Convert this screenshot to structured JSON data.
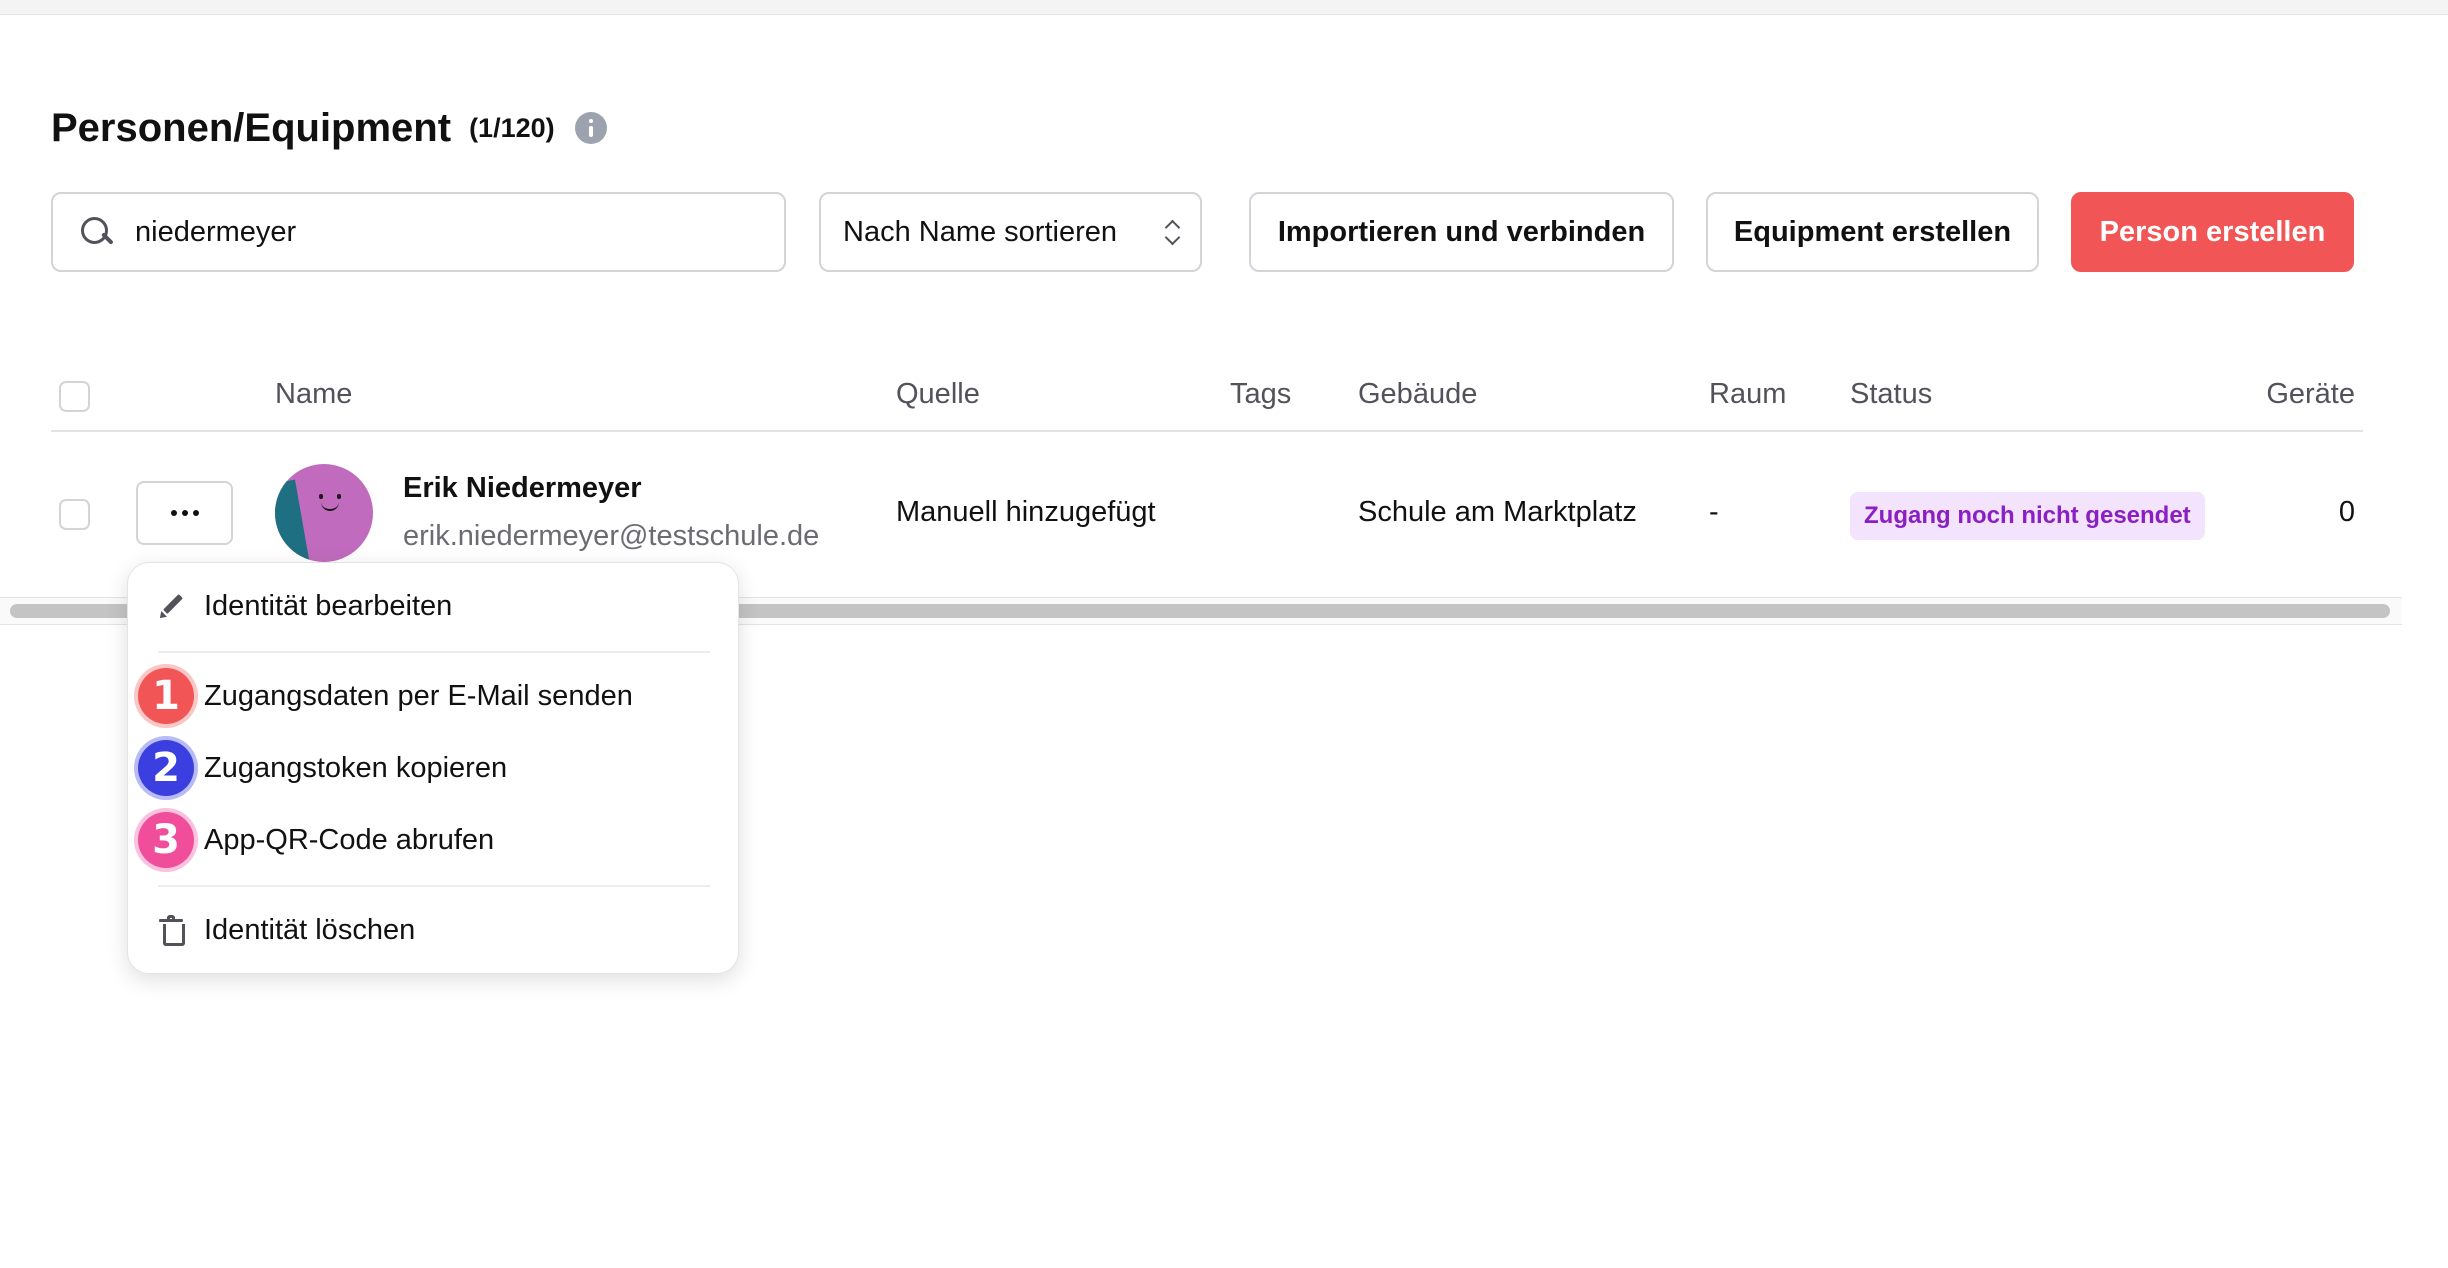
{
  "header": {
    "title": "Personen/Equipment",
    "count": "(1/120)"
  },
  "toolbar": {
    "search_value": "niedermeyer",
    "sort_label": "Nach Name sortieren",
    "import_label": "Importieren und verbinden",
    "equipment_label": "Equipment erstellen",
    "person_label": "Person erstellen"
  },
  "table": {
    "columns": [
      "Name",
      "Quelle",
      "Tags",
      "Gebäude",
      "Raum",
      "Status",
      "Geräte"
    ],
    "rows": [
      {
        "name": "Erik Niedermeyer",
        "email": "erik.niedermeyer@testschule.de",
        "source": "Manuell hinzugefügt",
        "tags": "",
        "building": "Schule am Marktplatz",
        "room": "-",
        "status": "Zugang noch nicht gesendet",
        "devices": "0"
      }
    ]
  },
  "menu": {
    "edit": "Identität bearbeiten",
    "send_email": "Zugangsdaten per E-Mail senden",
    "copy_token": "Zugangstoken kopieren",
    "qr_code": "App-QR-Code abrufen",
    "delete": "Identität löschen",
    "step_badges": [
      "1",
      "2",
      "3"
    ]
  },
  "colors": {
    "primary": "#f25555",
    "status_bg": "#f3e3fc",
    "status_text": "#8a1fc2",
    "badge_1": "#f25555",
    "badge_2": "#3b3fe0",
    "badge_3": "#f04d9b"
  },
  "icons": [
    "info-icon",
    "search-icon",
    "chevron-updown-icon",
    "more-icon",
    "pencil-icon",
    "trash-icon"
  ]
}
